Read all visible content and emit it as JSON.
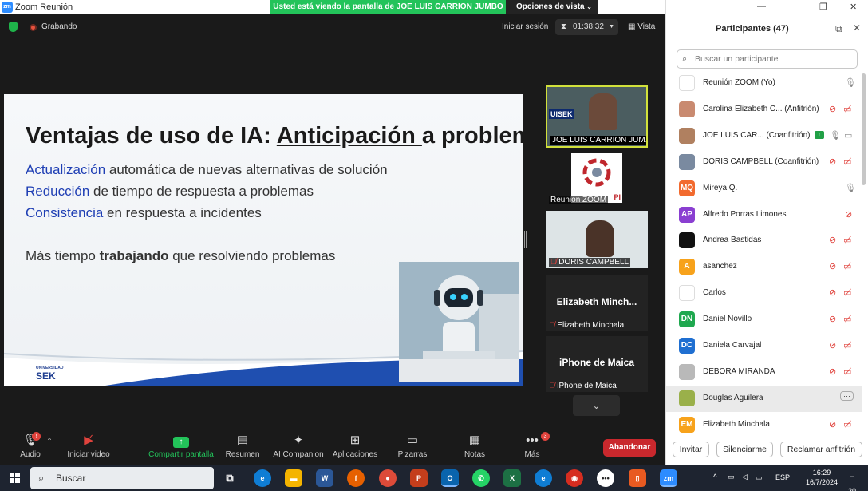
{
  "window": {
    "title": "Zoom Reunión",
    "controls": [
      "—",
      "❐",
      "✕"
    ]
  },
  "banner": {
    "text": "Usted está viendo la pantalla de JOE LUIS CARRION JUMBO",
    "view_options": "Opciones de vista"
  },
  "topbar": {
    "recording": "Grabando",
    "session": "Iniciar sesión",
    "timer": "01:38:32",
    "view": "Vista"
  },
  "slide": {
    "title_pre": "Ventajas de uso de IA: ",
    "title_ul": "Anticipación ",
    "title_post": "a problemas",
    "bullets": [
      {
        "kw": "Actualización",
        "rest": " automática de nuevas alternativas de solución"
      },
      {
        "kw": "Reducción",
        "rest": " de tiempo de respuesta a problemas"
      },
      {
        "kw": "Consistencia",
        "rest": " en respuesta a incidentes"
      }
    ],
    "slogan_pre": "Más tiempo ",
    "slogan_bold": "trabajando",
    "slogan_post": " que resolviendo problemas",
    "logo_line1": "UNIVERSIDAD",
    "logo_line2": "SEK"
  },
  "thumbnails": [
    {
      "label": "JOE LUIS CARRION JUM...",
      "logo": "UISEK"
    },
    {
      "label": "Reunion ZOOM",
      "tag": "PI"
    },
    {
      "label": "DORIS CAMPBELL"
    },
    {
      "big": "Elizabeth  Minch...",
      "label": "Elizabeth Minchala"
    },
    {
      "big": "iPhone de Maica",
      "label": "iPhone de Maica"
    }
  ],
  "toolbar": {
    "audio": "Audio",
    "video": "Iniciar video",
    "share": "Compartir pantalla",
    "summary": "Resumen",
    "companion": "AI Companion",
    "apps": "Aplicaciones",
    "whiteboards": "Pizarras",
    "notes": "Notas",
    "more": "Más",
    "more_badge": "3",
    "leave": "Abandonar"
  },
  "participants": {
    "title": "Participantes (47)",
    "search_placeholder": "Buscar un participante",
    "items": [
      {
        "name": "Reunión ZOOM (Yo)",
        "avatar": "",
        "color": "#ffffff"
      },
      {
        "name": "Carolina Elizabeth C...  (Anfitrión)",
        "avatar": "",
        "color": "#c98a70"
      },
      {
        "name": "JOE LUIS CAR...  (Coanfitrión)",
        "avatar": "",
        "color": "#b08060"
      },
      {
        "name": "DORIS CAMPBELL  (Coanfitrión)",
        "avatar": "",
        "color": "#7a8aa0"
      },
      {
        "name": "Mireya Q.",
        "avatar": "MQ",
        "color": "#f26a2e"
      },
      {
        "name": "Alfredo Porras Limones",
        "avatar": "AP",
        "color": "#8a3fd1"
      },
      {
        "name": "Andrea Bastidas",
        "avatar": "",
        "color": "#111111"
      },
      {
        "name": "asanchez",
        "avatar": "A",
        "color": "#f7a21b"
      },
      {
        "name": "Carlos",
        "avatar": "",
        "color": "#ffffff"
      },
      {
        "name": "Daniel Novillo",
        "avatar": "DN",
        "color": "#1fa84f"
      },
      {
        "name": "Daniela Carvajal",
        "avatar": "DC",
        "color": "#1f6fd1"
      },
      {
        "name": "DEBORA MIRANDA",
        "avatar": "",
        "color": "#b9b9b9"
      },
      {
        "name": "Douglas Aguilera",
        "avatar": "",
        "color": "#9ab04a"
      },
      {
        "name": "Elizabeth Minchala",
        "avatar": "EM",
        "color": "#f7a21b"
      }
    ],
    "invite": "Invitar",
    "mute_me": "Silenciarme",
    "claim_host": "Reclamar anfitrión"
  },
  "taskbar": {
    "search": "Buscar",
    "lang": "ESP",
    "time": "16:29",
    "date": "16/7/2024",
    "notifications": "20"
  }
}
